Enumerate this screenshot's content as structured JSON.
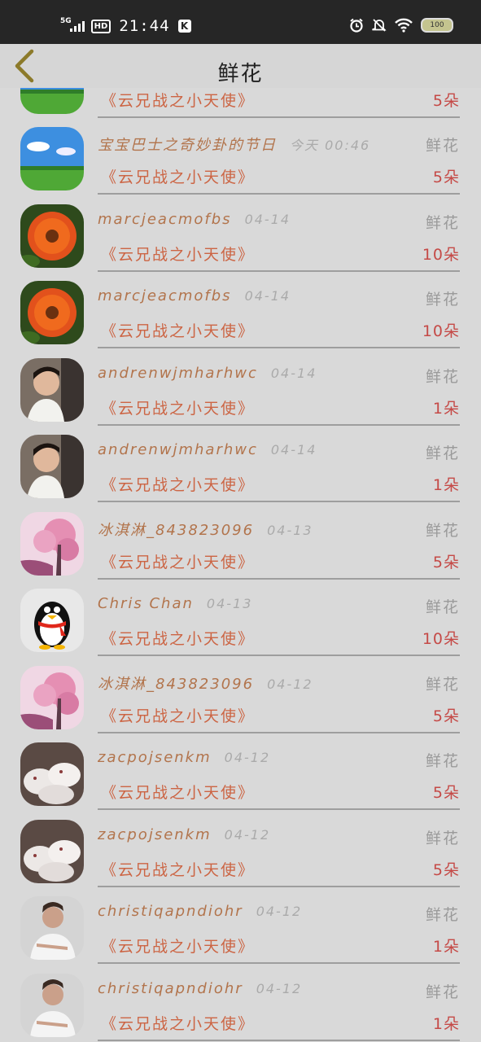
{
  "status_bar": {
    "network": "5G",
    "hd": "HD",
    "time": "21:44",
    "k_badge": "K",
    "battery": "100"
  },
  "header": {
    "title": "鲜花"
  },
  "rows": [
    {
      "name": "",
      "date": "",
      "gift": "",
      "work": "《云兄战之小天使》",
      "count": "5朵",
      "avatar": "landscape-avatar"
    },
    {
      "name": "宝宝巴士之奇妙卦的节日",
      "date": "今天 00:46",
      "gift": "鲜花",
      "work": "《云兄战之小天使》",
      "count": "5朵",
      "avatar": "landscape-avatar"
    },
    {
      "name": "marcjeacmofbs",
      "date": "04-14",
      "gift": "鲜花",
      "work": "《云兄战之小天使》",
      "count": "10朵",
      "avatar": "flower-avatar"
    },
    {
      "name": "marcjeacmofbs",
      "date": "04-14",
      "gift": "鲜花",
      "work": "《云兄战之小天使》",
      "count": "10朵",
      "avatar": "flower-avatar"
    },
    {
      "name": "andrenwjmharhwc",
      "date": "04-14",
      "gift": "鲜花",
      "work": "《云兄战之小天使》",
      "count": "1朵",
      "avatar": "person-avatar"
    },
    {
      "name": "andrenwjmharhwc",
      "date": "04-14",
      "gift": "鲜花",
      "work": "《云兄战之小天使》",
      "count": "1朵",
      "avatar": "person-avatar"
    },
    {
      "name": "冰淇淋_843823096",
      "date": "04-13",
      "gift": "鲜花",
      "work": "《云兄战之小天使》",
      "count": "5朵",
      "avatar": "blossom-avatar"
    },
    {
      "name": "Chris Chan",
      "date": "04-13",
      "gift": "鲜花",
      "work": "《云兄战之小天使》",
      "count": "10朵",
      "avatar": "penguin-avatar"
    },
    {
      "name": "冰淇淋_843823096",
      "date": "04-12",
      "gift": "鲜花",
      "work": "《云兄战之小天使》",
      "count": "5朵",
      "avatar": "blossom-avatar"
    },
    {
      "name": "zacpojsenkm",
      "date": "04-12",
      "gift": "鲜花",
      "work": "《云兄战之小天使》",
      "count": "5朵",
      "avatar": "rabbit-avatar"
    },
    {
      "name": "zacpojsenkm",
      "date": "04-12",
      "gift": "鲜花",
      "work": "《云兄战之小天使》",
      "count": "5朵",
      "avatar": "rabbit-avatar"
    },
    {
      "name": "christiqapndiohr",
      "date": "04-12",
      "gift": "鲜花",
      "work": "《云兄战之小天使》",
      "count": "1朵",
      "avatar": "man-avatar"
    },
    {
      "name": "christiqapndiohr",
      "date": "04-12",
      "gift": "鲜花",
      "work": "《云兄战之小天使》",
      "count": "1朵",
      "avatar": "man-avatar"
    }
  ]
}
